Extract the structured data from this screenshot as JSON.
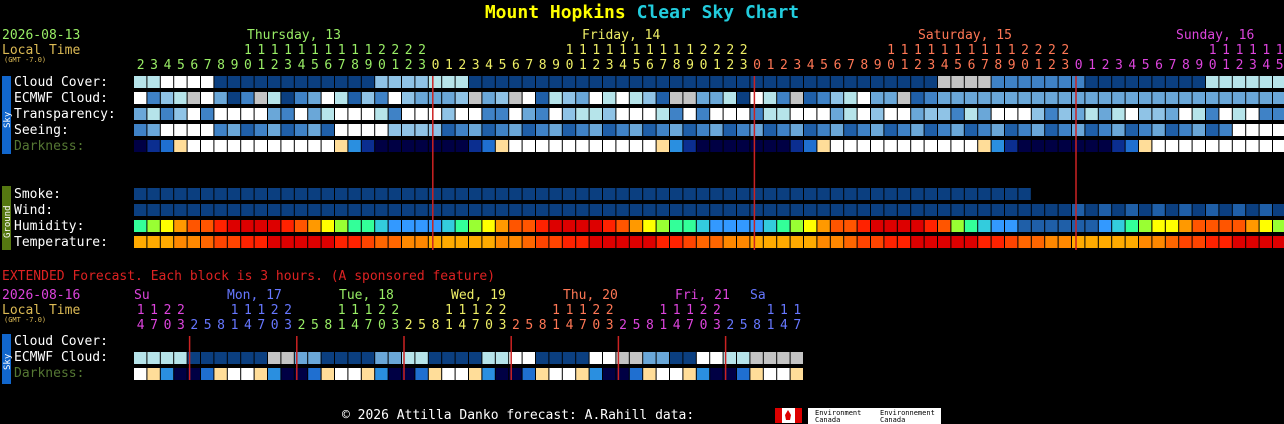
{
  "title": {
    "part1": "Mount Hopkins",
    "part2": "Clear Sky Chart"
  },
  "date": "2026-08-13",
  "local_time": "Local Time",
  "gmt": "(GMT -7.0)",
  "days": [
    {
      "label": "Thursday, 13",
      "color": "#99ee66"
    },
    {
      "label": "Friday, 14",
      "color": "#eeee66"
    },
    {
      "label": "Saturday, 15",
      "color": "#ff7755"
    },
    {
      "label": "Sunday, 16",
      "color": "#dd44dd"
    }
  ],
  "hours": [
    2,
    3,
    4,
    5,
    6,
    7,
    8,
    9,
    10,
    11,
    12,
    13,
    14,
    15,
    16,
    17,
    18,
    19,
    20,
    21,
    22,
    23,
    0,
    1,
    2,
    3,
    4,
    5,
    6,
    7,
    8,
    9,
    10,
    11,
    12,
    13,
    14,
    15,
    16,
    17,
    18,
    19,
    20,
    21,
    22,
    23,
    0,
    1,
    2,
    3,
    4,
    5,
    6,
    7,
    8,
    9,
    10,
    11,
    12,
    13,
    14,
    15,
    16,
    17,
    18,
    19,
    20,
    21,
    22,
    23,
    0,
    1,
    2,
    3,
    4,
    5,
    6,
    7,
    8,
    9,
    10,
    11,
    12,
    13,
    14,
    15,
    16,
    17,
    18,
    19,
    20,
    21,
    22,
    23,
    0,
    1,
    2,
    3,
    4,
    5,
    6,
    7,
    8,
    9,
    10,
    11
  ],
  "sky_label": "Sky",
  "ground_label": "Ground",
  "rows": {
    "cloud_cover": {
      "label": "Cloud Cover:",
      "values": [
        "L",
        "L",
        "W",
        "W",
        "W",
        "D",
        "D",
        "D",
        "D",
        "D",
        "D",
        "D",
        "D",
        "D",
        "D",
        "D",
        "D",
        "D",
        "D",
        "D",
        "D",
        "D",
        "D",
        "D",
        "D",
        "D",
        "D",
        "D",
        "D",
        "D",
        "D",
        "D",
        "D",
        "D",
        "D",
        "D",
        "D",
        "D",
        "D",
        "D",
        "D",
        "D",
        "D",
        "D",
        "D",
        "D",
        "D",
        "D",
        "D",
        "D",
        "D",
        "D",
        "D",
        "D",
        "D",
        "D",
        "D",
        "D",
        "D",
        "D",
        "D",
        "D",
        "D",
        "D",
        "D",
        "D",
        "D",
        "D",
        "D",
        "D",
        "D",
        "D",
        "D",
        "D",
        "D",
        "D",
        "D",
        "D",
        "D",
        "D",
        "D",
        "D",
        "D",
        "D",
        "D",
        "D",
        "D",
        "D",
        "D",
        "D",
        "D",
        "D",
        "D",
        "D",
        "D",
        "D",
        "D",
        "D",
        "D",
        "D",
        "D",
        "D",
        "D",
        "D",
        "D",
        "D",
        "D",
        "D",
        "D",
        "D",
        "D",
        "D",
        "D",
        "D",
        "D",
        "D",
        "D",
        "D",
        "D",
        "D",
        "D",
        "D",
        "D",
        "D",
        "D",
        "D",
        "D",
        "D",
        "D",
        "D",
        "D",
        "D",
        "D",
        "D",
        "D",
        "D"
      ]
    },
    "ecmwf_cloud": {
      "label": "ECMWF Cloud:"
    },
    "transparency": {
      "label": "Transparency:"
    },
    "seeing": {
      "label": "Seeing:"
    },
    "darkness": {
      "label": "Darkness:"
    },
    "smoke": {
      "label": "Smoke:"
    },
    "wind": {
      "label": "Wind:"
    },
    "humidity": {
      "label": "Humidity:"
    },
    "temperature": {
      "label": "Temperature:"
    }
  },
  "extended": {
    "notice": "EXTENDED Forecast. Each block is 3 hours. (A sponsored feature)",
    "date": "2026-08-16",
    "local_time": "Local Time",
    "gmt": "(GMT -7.0)",
    "days": [
      {
        "label": "Su",
        "color": "#dd44dd"
      },
      {
        "label": "Mon, 17",
        "color": "#6677ff"
      },
      {
        "label": "Tue, 18",
        "color": "#99ee66"
      },
      {
        "label": "Wed, 19",
        "color": "#eeee66"
      },
      {
        "label": "Thu, 20",
        "color": "#ff7755"
      },
      {
        "label": "Fri, 21",
        "color": "#dd44dd"
      },
      {
        "label": "Sa",
        "color": "#6677ff"
      }
    ],
    "hours": [
      14,
      17,
      20,
      23,
      2,
      5,
      8,
      11,
      14,
      17,
      20,
      23,
      2,
      5,
      8,
      11,
      14,
      17,
      20,
      23,
      2,
      5,
      8,
      11,
      14,
      17,
      20,
      23,
      2,
      5,
      8,
      11,
      14,
      17,
      20,
      23,
      2,
      5,
      8,
      11,
      14,
      17,
      20,
      23,
      2,
      5,
      8,
      11,
      14,
      17,
      20,
      23,
      2,
      5,
      8,
      11
    ],
    "rows": {
      "cloud_cover": {
        "label": "Cloud Cover:"
      },
      "ecmwf_cloud": {
        "label": "ECMWF Cloud:"
      },
      "darkness": {
        "label": "Darkness:"
      }
    }
  },
  "footer": {
    "text": "© 2026 Attilla Danko  forecast: A.Rahill  data:",
    "env1": "Environment Canada",
    "env2": "Environnement Canada"
  },
  "colors": {
    "accent_title": "#ffff00",
    "accent_title2": "#22ccdd",
    "midnight_line": "#cc2222",
    "darkness_label": "#557733",
    "extended_notice": "#dd2222"
  },
  "chart_data": {
    "type": "heatmap",
    "title": "Mount Hopkins Clear Sky Chart",
    "x": "hour blocks from 2026-08-13 02:00 to 2026-08-16 11:00",
    "series": [
      {
        "name": "Cloud Cover",
        "values": []
      },
      {
        "name": "ECMWF Cloud",
        "values": []
      },
      {
        "name": "Transparency",
        "values": []
      },
      {
        "name": "Seeing",
        "values": []
      },
      {
        "name": "Darkness",
        "values": []
      },
      {
        "name": "Smoke",
        "values": []
      },
      {
        "name": "Wind",
        "values": []
      },
      {
        "name": "Humidity",
        "values": []
      },
      {
        "name": "Temperature",
        "values": []
      }
    ]
  }
}
